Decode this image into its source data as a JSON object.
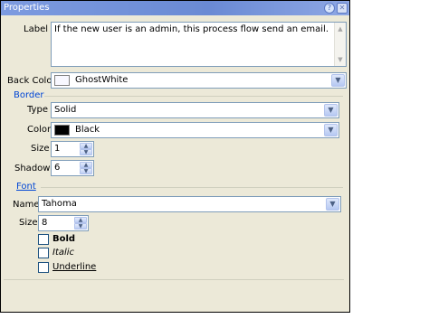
{
  "window": {
    "title": "Properties"
  },
  "fields": {
    "label": {
      "label": "Label",
      "value": "If the new user is an admin, this process flow send an email."
    },
    "back_color": {
      "label": "Back Color",
      "value": "GhostWhite",
      "swatch": "#f8f8ff"
    }
  },
  "border": {
    "heading": "Border",
    "type": {
      "label": "Type",
      "value": "Solid"
    },
    "color": {
      "label": "Color",
      "value": "Black",
      "swatch": "#000000"
    },
    "size": {
      "label": "Size",
      "value": "1"
    },
    "shadow": {
      "label": "Shadow",
      "value": "6"
    }
  },
  "font": {
    "heading": "Font",
    "name": {
      "label": "Name",
      "value": "Tahoma"
    },
    "size": {
      "label": "Size",
      "value": "8"
    },
    "bold": {
      "label": "Bold",
      "checked": false
    },
    "italic": {
      "label": "Italic",
      "checked": false
    },
    "underline": {
      "label": "Underline",
      "checked": false
    }
  },
  "icons": {
    "titlebar_help": "help-icon",
    "titlebar_close": "close-icon",
    "dropdown": "chevron-down-icon",
    "spin_up": "arrow-up-icon",
    "spin_down": "arrow-down-icon"
  }
}
